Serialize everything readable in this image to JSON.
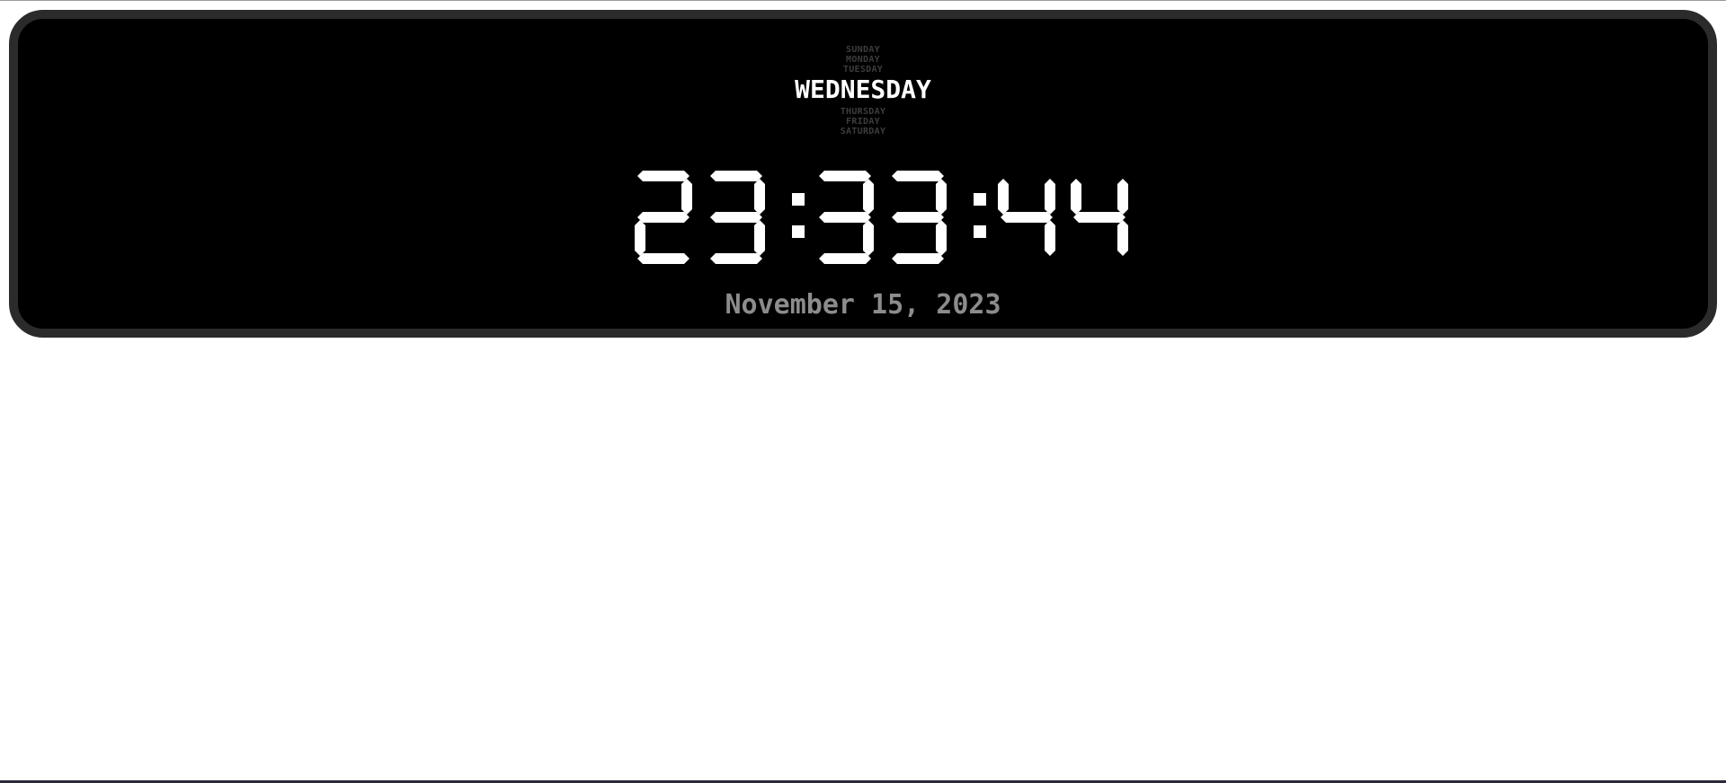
{
  "clock": {
    "days_before": [
      "SUNDAY",
      "MONDAY",
      "TUESDAY"
    ],
    "current_day": "WEDNESDAY",
    "days_after": [
      "THURSDAY",
      "FRIDAY",
      "SATURDAY"
    ],
    "time": "23:33:44",
    "date": "November 15, 2023"
  },
  "colors": {
    "frame": "#2b2b2b",
    "face": "#000000",
    "active_text": "#ffffff",
    "inactive_day_text": "#3d3d3d",
    "date_text": "#8c8c8c"
  }
}
